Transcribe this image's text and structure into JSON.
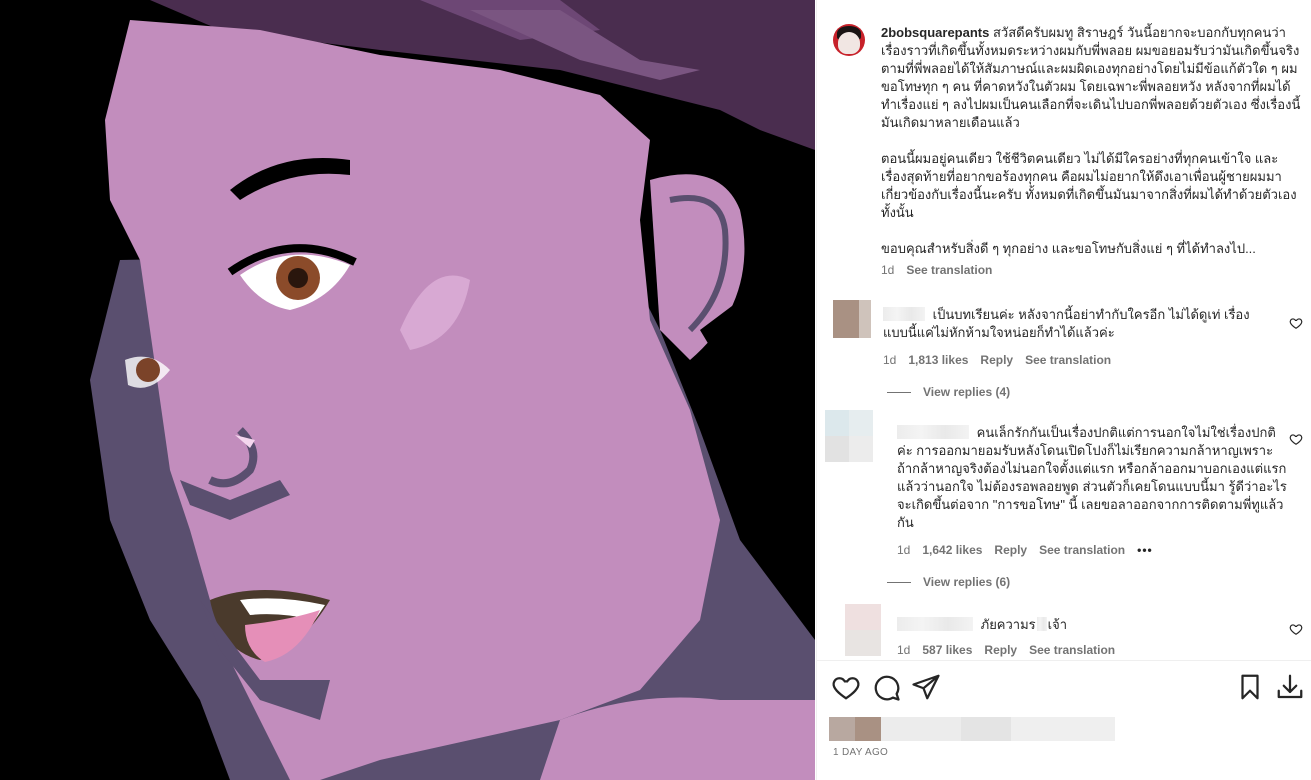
{
  "post": {
    "username": "2bobsquarepants",
    "caption_paragraphs": [
      "สวัสดีครับผมทู สิราษฎร์ วันนี้อยากจะบอกกับทุกคนว่าเรื่องราวที่เกิดขึ้นทั้งหมดระหว่างผมกับพี่พลอย ผมขอยอมรับว่ามันเกิดขึ้นจริงตามที่พี่พลอยได้ให้สัมภาษณ์และผมผิดเองทุกอย่างโดยไม่มีข้อแก้ตัวใด ๆ ผมขอโทษทุก ๆ คน ที่คาดหวังในตัวผม โดยเฉพาะพี่พลอยหวัง หลังจากที่ผมได้ทำเรื่องแย่ ๆ ลงไปผมเป็นคนเลือกที่จะเดินไปบอกพี่พลอยด้วยตัวเอง ซึ่งเรื่องนี้มันเกิดมาหลายเดือนแล้ว",
      "ตอนนี้ผมอยู่คนเดียว ใช้ชีวิตคนเดียว ไม่ได้มีใครอย่างที่ทุกคนเข้าใจ และเรื่องสุดท้ายที่อยากขอร้องทุกคน คือผมไม่อยากให้ดึงเอาเพื่อนผู้ชายผมมาเกี่ยวข้องกับเรื่องนี้นะครับ ทั้งหมดที่เกิดขึ้นมันมาจากสิ่งที่ผมได้ทำด้วยตัวเองทั้งนั้น",
      "ขอบคุณสำหรับสิ่งดี ๆ ทุกอย่าง และขอโทษกับสิ่งแย่ ๆ ที่ได้ทำลงไป..."
    ],
    "age": "1d",
    "see_translation": "See translation"
  },
  "comments": [
    {
      "text": "เป็นบทเรียนค่ะ หลังจากนี้อย่าทำกับใครอีก ไม่ได้ดูเท่ เรื่องแบบนี้แค่ไม่หักห้ามใจหน่อยก็ทำได้แล้วค่ะ",
      "age": "1d",
      "likes": "1,813 likes",
      "reply": "Reply",
      "see_translation": "See translation",
      "view_replies": "View replies (4)"
    },
    {
      "text": "คนเล็กรักกันเป็นเรื่องปกติแต่การนอกใจไม่ใช่เรื่องปกติค่ะ การออกมายอมรับหลังโดนเปิดโปงก็ไม่เรียกความกล้าหาญเพราะถ้ากล้าหาญจริงต้องไม่นอกใจตั้งแต่แรก หรือกล้าออกมาบอกเองแต่แรกแล้วว่านอกใจ ไม่ต้องรอพลอยพูด ส่วนตัวก็เคยโดนแบบนี้มา รู้ดีว่าอะไรจะเกิดขึ้นต่อจาก \"การขอโทษ\" นี้ เลยขอลาออกจากการติดตามพี่ทูแล้วกัน",
      "age": "1d",
      "likes": "1,642 likes",
      "reply": "Reply",
      "see_translation": "See translation",
      "more": "•••",
      "view_replies": "View replies (6)"
    },
    {
      "text": "ภัยความร",
      "text_tail": "เจ้า",
      "age": "1d",
      "likes": "587 likes",
      "reply": "Reply",
      "see_translation": "See translation"
    }
  ],
  "footer": {
    "timestamp": "1 DAY AGO"
  },
  "icons": {
    "like": "heart-icon",
    "comment": "comment-icon",
    "share": "send-icon",
    "save": "bookmark-icon",
    "download": "download-icon"
  },
  "colors": {
    "text": "#262626",
    "secondary": "#737373",
    "avatar_ring": "#c7212a",
    "art_skin": "#c28dbd",
    "art_shadow": "#5a4f6f",
    "art_hair": "#4a2d4f"
  }
}
